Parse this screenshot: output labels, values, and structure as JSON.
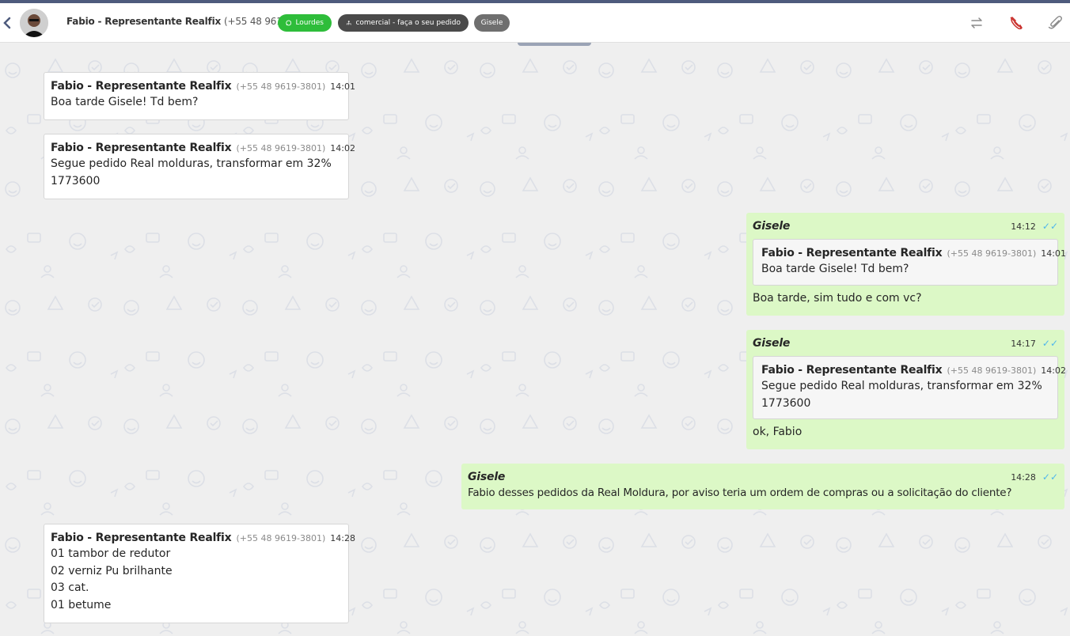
{
  "header": {
    "contact_name": "Fabio - Representante Realfix",
    "contact_phone": "(+55 48 9619-3801)",
    "tags": {
      "whatsapp": "Lourdes",
      "queue": "comercial - faça o seu pedido",
      "user": "Gisele"
    },
    "icons": [
      "chevron-left-icon",
      "transfer-icon",
      "end-call-icon",
      "paperclip-icon"
    ],
    "colors": {
      "whatsapp_tag": "#2ebd3a",
      "queue_tag": "#4a4a4a",
      "user_tag": "#6f6f6f",
      "outgoing_bubble": "#dcf8c6",
      "read_ticks": "#4fb6ec"
    }
  },
  "messages": [
    {
      "direction": "in",
      "sender": "Fabio - Representante Realfix",
      "phone": "(+55 48 9619-3801)",
      "time": "14:01",
      "text": "Boa tarde Gisele! Td bem?"
    },
    {
      "direction": "in",
      "sender": "Fabio - Representante Realfix",
      "phone": "(+55 48 9619-3801)",
      "time": "14:02",
      "text": "Segue pedido Real molduras, transformar em 32%\n1773600"
    },
    {
      "direction": "out",
      "sender": "Gisele",
      "time": "14:12",
      "quote": {
        "sender": "Fabio - Representante Realfix",
        "phone": "(+55 48 9619-3801)",
        "time": "14:01",
        "text": "Boa tarde Gisele! Td bem?"
      },
      "text": "Boa tarde, sim tudo e com vc?"
    },
    {
      "direction": "out",
      "sender": "Gisele",
      "time": "14:17",
      "quote": {
        "sender": "Fabio - Representante Realfix",
        "phone": "(+55 48 9619-3801)",
        "time": "14:02",
        "text": "Segue pedido Real molduras, transformar em 32%\n1773600"
      },
      "text": "ok, Fabio"
    },
    {
      "direction": "out",
      "sender": "Gisele",
      "time": "14:28",
      "text": "Fabio desses pedidos da Real Moldura, por aviso teria um ordem de compras ou a solicitação do cliente?"
    },
    {
      "direction": "in",
      "sender": "Fabio - Representante Realfix",
      "phone": "(+55 48 9619-3801)",
      "time": "14:28",
      "text": "01 tambor de redutor\n02 verniz Pu brilhante\n03 cat.\n01 betume"
    }
  ]
}
